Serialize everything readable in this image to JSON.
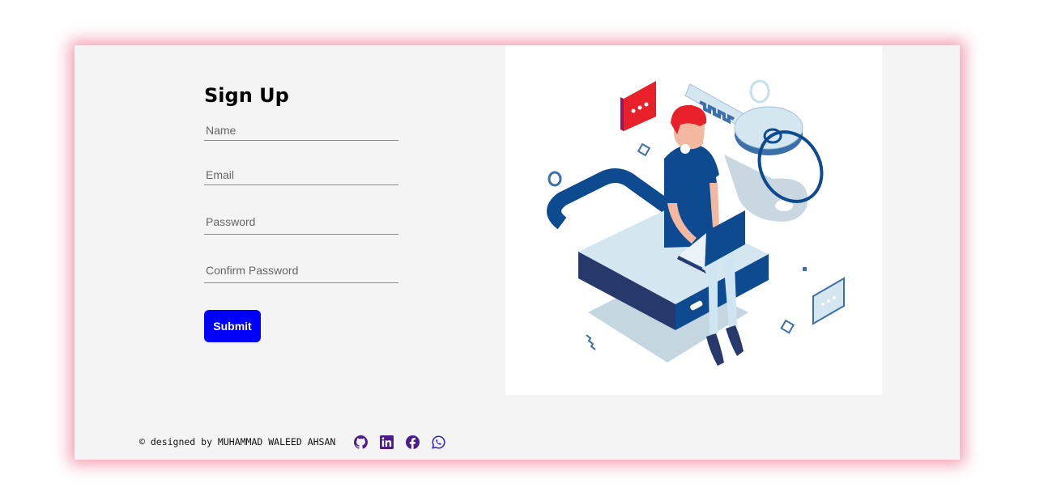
{
  "form": {
    "title": "Sign Up",
    "fields": {
      "name": {
        "placeholder": "Name",
        "value": ""
      },
      "email": {
        "placeholder": "Email",
        "value": ""
      },
      "password": {
        "placeholder": "Password",
        "value": ""
      },
      "confirm_password": {
        "placeholder": "Confirm Password",
        "value": ""
      }
    },
    "submit_label": "Submit"
  },
  "footer": {
    "credit": "© designed by MUHAMMAD WALEED AHSAN",
    "social_links": [
      {
        "icon": "github-icon"
      },
      {
        "icon": "linkedin-icon"
      },
      {
        "icon": "facebook-icon"
      },
      {
        "icon": "whatsapp-icon"
      }
    ]
  },
  "colors": {
    "submit_bg": "#0000ff",
    "card_bg": "#f4f4f4",
    "card_glow": "#e62850",
    "social_icons": "#4b1c8c",
    "whatsapp_icon": "#2a1fd0",
    "illustration_primary": "#0d4a8f",
    "illustration_light": "#d4e6f0",
    "illustration_accent": "#e8202a"
  }
}
